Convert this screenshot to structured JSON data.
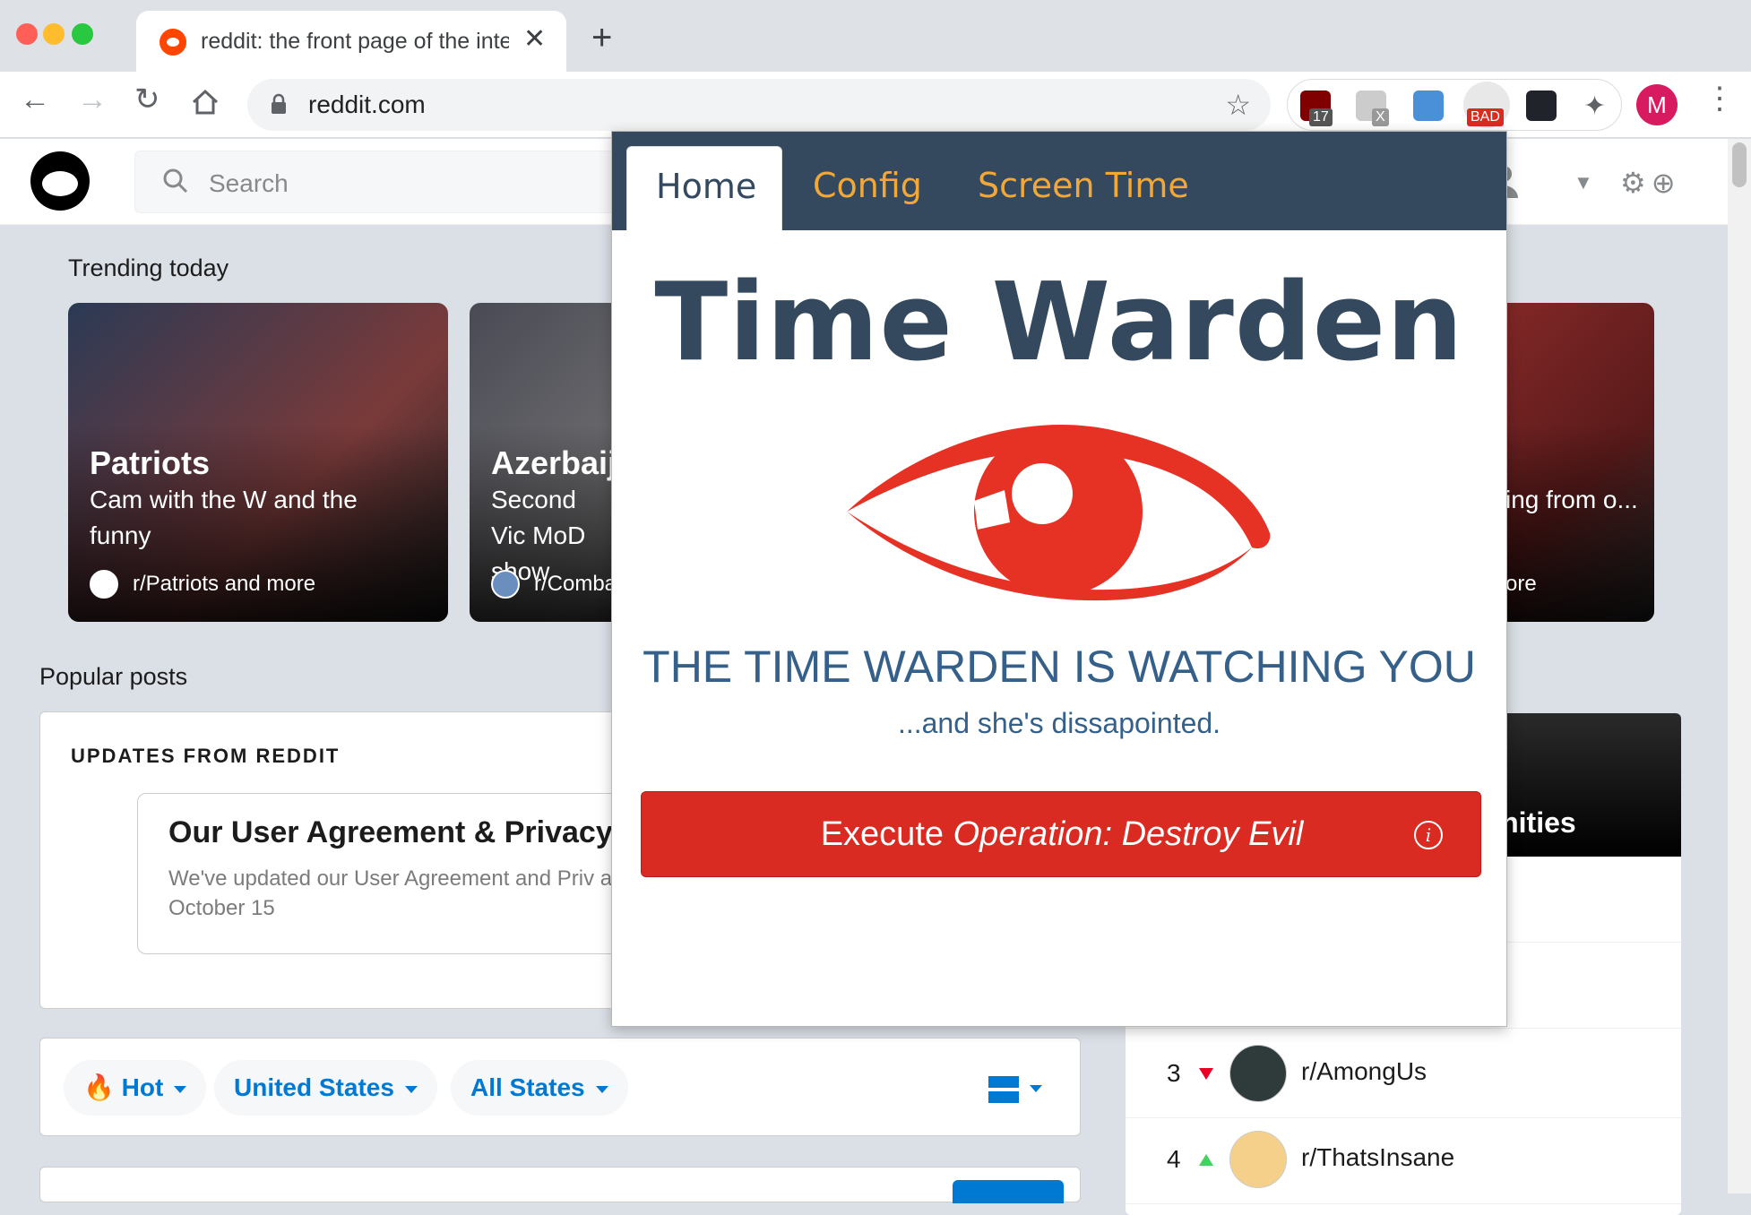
{
  "browser": {
    "tab_title": "reddit: the front page of the internet",
    "tab_close": "✕",
    "new_tab": "+",
    "url": "reddit.com",
    "extensions": [
      {
        "name": "ublock-extension-icon",
        "badge": "17"
      },
      {
        "name": "mail-extension-icon",
        "badge": "X"
      },
      {
        "name": "window-extension-icon",
        "badge": ""
      },
      {
        "name": "time-warden-extension-icon",
        "badge": "BAD"
      },
      {
        "name": "react-devtools-extension-icon",
        "badge": ""
      },
      {
        "name": "extensions-puzzle-icon",
        "badge": ""
      }
    ],
    "profile_initial": "M"
  },
  "reddit": {
    "search_placeholder": "Search",
    "trending_label": "Trending today",
    "trending": [
      {
        "title": "Patriots",
        "subtitle": "Cam with the W and the funny",
        "community": "r/Patriots and more"
      },
      {
        "title": "Azerbaij",
        "subtitle": "Second Vic MoD show",
        "community": "r/Comba"
      },
      {
        "title": "",
        "subtitle": "ing from o...",
        "community": "ore"
      }
    ],
    "popular_label": "Popular posts",
    "updates_label": "UPDATES FROM REDDIT",
    "agreement_title": "Our User Agreement & Privacy",
    "agreement_text": "We've updated our User Agreement and Priv a look, as the changes take effect October 15",
    "sort": {
      "hot": "Hot",
      "location": "United States",
      "states": "All States"
    },
    "sidebar": {
      "banner_text": "nunities",
      "communities": [
        {
          "rank": "3",
          "trend": "down",
          "name": "r/AmongUs"
        },
        {
          "rank": "4",
          "trend": "up",
          "name": "r/ThatsInsane"
        }
      ]
    }
  },
  "popup": {
    "tabs": {
      "home": "Home",
      "config": "Config",
      "screen_time": "Screen Time"
    },
    "title": "Time Warden",
    "watching": "THE TIME WARDEN IS WATCHING YOU",
    "subtitle": "...and she's dissapointed.",
    "button_prefix": "Execute ",
    "button_emphasis": "Operation: Destroy Evil",
    "info_glyph": "i",
    "colors": {
      "navy": "#34495e",
      "accent": "#f1a83a",
      "red": "#d92b21",
      "text_blue": "#34608a"
    }
  }
}
